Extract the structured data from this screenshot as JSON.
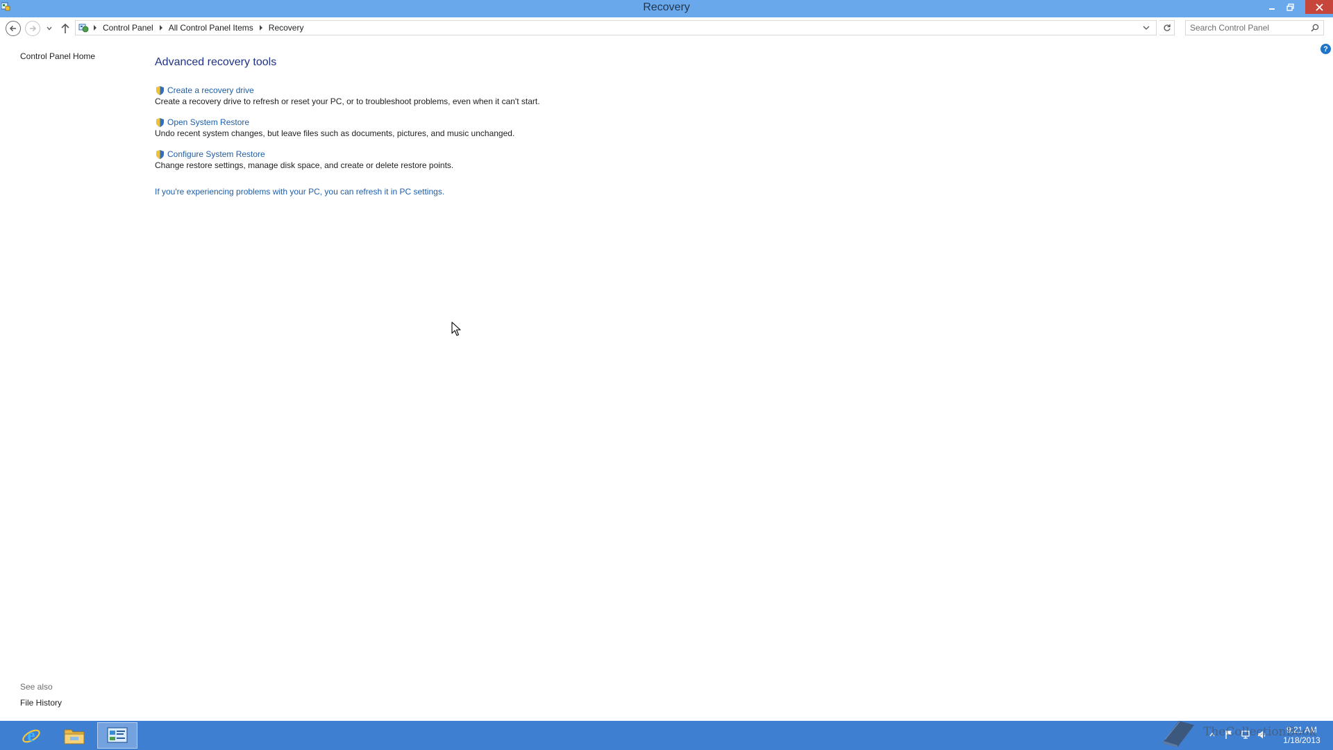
{
  "window": {
    "title": "Recovery"
  },
  "navigation": {
    "breadcrumbs": [
      "Control Panel",
      "All Control Panel Items",
      "Recovery"
    ],
    "search_placeholder": "Search Control Panel"
  },
  "left_pane": {
    "home_link": "Control Panel Home",
    "see_also_heading": "See also",
    "see_also_links": [
      "File History"
    ]
  },
  "main": {
    "heading": "Advanced recovery tools",
    "tasks": [
      {
        "link": "Create a recovery drive",
        "description": "Create a recovery drive to refresh or reset your PC, or to troubleshoot problems, even when it can't start."
      },
      {
        "link": "Open System Restore",
        "description": "Undo recent system changes, but leave files such as documents, pictures, and music unchanged."
      },
      {
        "link": "Configure System Restore",
        "description": "Change restore settings, manage disk space, and create or delete restore points."
      }
    ],
    "refresh_link": "If you're experiencing problems with your PC, you can refresh it in PC settings."
  },
  "taskbar": {
    "pinned": [
      "internet-explorer-icon",
      "file-explorer-icon",
      "control-panel-icon"
    ],
    "active": "control-panel-icon",
    "clock_time": "9:21 AM",
    "clock_date": "1/18/2013"
  },
  "watermark": {
    "text": "TheCollectionBook"
  },
  "colors": {
    "titlebar": "#6aa8ec",
    "taskbar": "#3f7fd1",
    "link": "#1e5ea8",
    "heading": "#1e3287",
    "close_button": "#c7463b"
  }
}
